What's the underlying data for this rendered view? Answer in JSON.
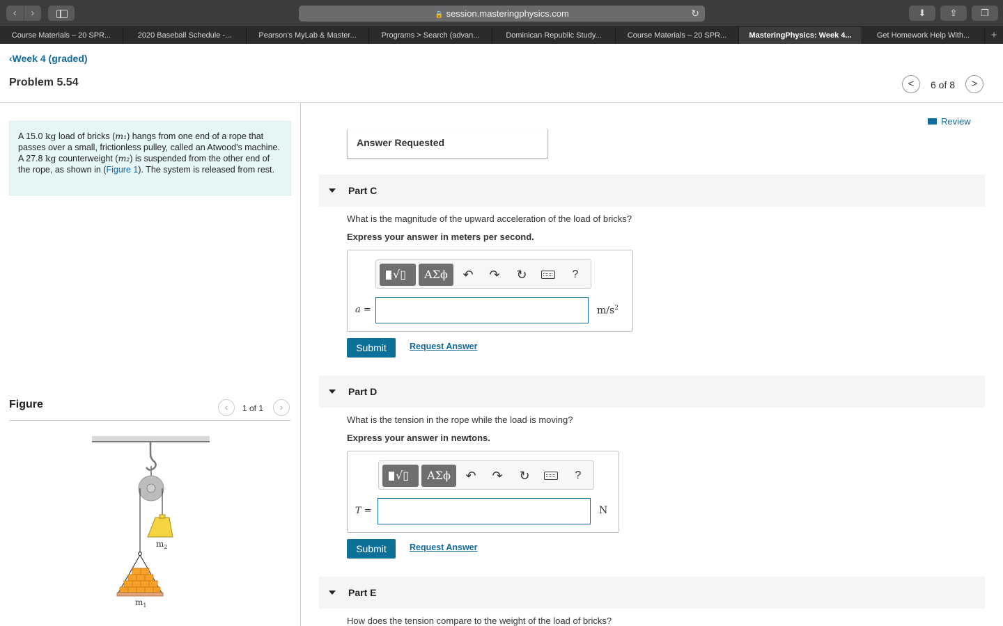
{
  "browser": {
    "url": "session.masteringphysics.com",
    "tabs": [
      {
        "label": "Course Materials – 20 SPR...",
        "active": false
      },
      {
        "label": "2020 Baseball Schedule -...",
        "active": false
      },
      {
        "label": "Pearson's MyLab & Master...",
        "active": false
      },
      {
        "label": "Programs > Search (advan...",
        "active": false
      },
      {
        "label": "Dominican Republic Study...",
        "active": false
      },
      {
        "label": "Course Materials – 20 SPR...",
        "active": false
      },
      {
        "label": "MasteringPhysics: Week 4...",
        "active": true
      },
      {
        "label": "Get Homework Help With...",
        "active": false
      }
    ],
    "new_tab": "+"
  },
  "header": {
    "back_label": "Week 4 (graded)",
    "problem_title": "Problem 5.54",
    "pager": "6 of 8",
    "prev": "<",
    "next": ">"
  },
  "problem": {
    "t1": "A 15.0 ",
    "kg1": "kg",
    "t2": " load of bricks (",
    "m1": "m₁",
    "t3": ") hangs from one end of a rope that passes over a small, frictionless pulley, called an Atwood's machine. A 27.8 ",
    "kg2": "kg",
    "t4": " counterweight (",
    "m2": "m₂",
    "t5": ") is suspended from the other end of the rope, as shown in (",
    "fig_link": "Figure 1",
    "t6": "). The system is released from rest."
  },
  "figure": {
    "title": "Figure",
    "pager": "1 of 1",
    "label_m2": "m",
    "label_m2_sub": "2",
    "label_m1": "m",
    "label_m1_sub": "1"
  },
  "review": "Review",
  "answer_requested": "Answer Requested",
  "toolbar": {
    "greek": "ΑΣϕ",
    "undo": "↶",
    "redo": "↷",
    "reset": "↻",
    "help": "?"
  },
  "part_c": {
    "label": "Part C",
    "question": "What is the magnitude of the upward acceleration of the load of bricks?",
    "instruction": "Express your answer in meters per second.",
    "var": "a",
    "eq": " =",
    "unit": "m/s",
    "unit_sup": "2",
    "value": "",
    "submit": "Submit",
    "request": "Request Answer"
  },
  "part_d": {
    "label": "Part D",
    "question": "What is the tension in the rope while the load is moving?",
    "instruction": "Express your answer in newtons.",
    "var": "T",
    "eq": " =",
    "unit": "N",
    "value": "",
    "submit": "Submit",
    "request": "Request Answer"
  },
  "part_e": {
    "label": "Part E",
    "question": "How does the tension compare to the weight of the load of bricks?"
  }
}
